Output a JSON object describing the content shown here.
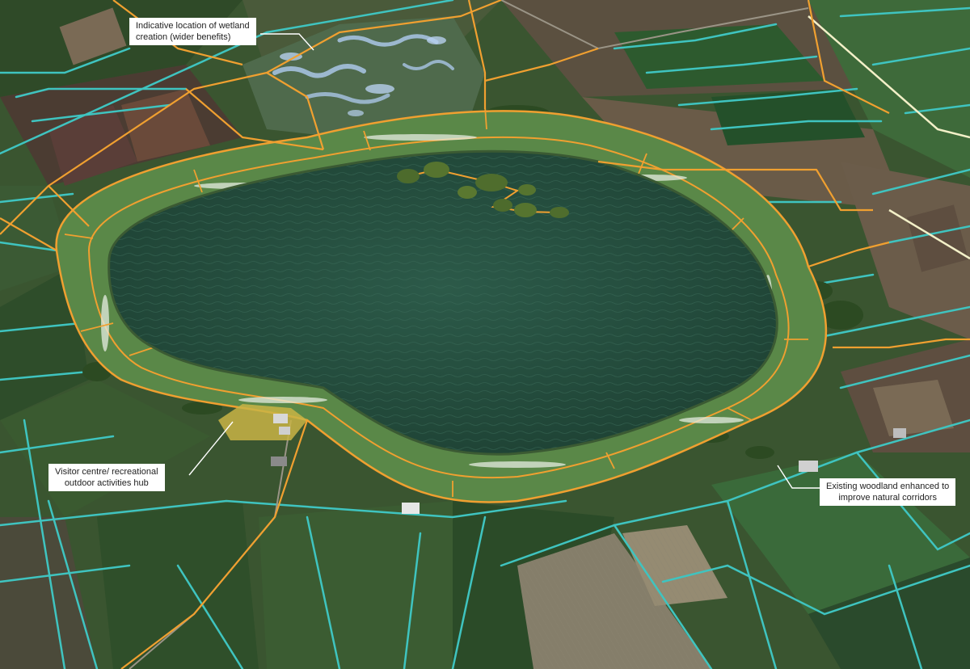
{
  "callouts": {
    "wetland": {
      "line1": "Indicative location of wetland",
      "line2": "creation (wider benefits)"
    },
    "visitor": {
      "line1": "Visitor centre/ recreational",
      "line2": "outdoor activities hub"
    },
    "woodland": {
      "line1": "Existing woodland enhanced to",
      "line2": "improve natural corridors"
    }
  },
  "colors": {
    "reservoir_water": "#27503f",
    "embankment_grass": "#5e8c4c",
    "boundary_orange": "#f0a030",
    "drain_cyan": "#3fc4c0",
    "field_dark": "#35502c",
    "field_light": "#6a5a45",
    "wetland_water": "#a9c6e6"
  }
}
